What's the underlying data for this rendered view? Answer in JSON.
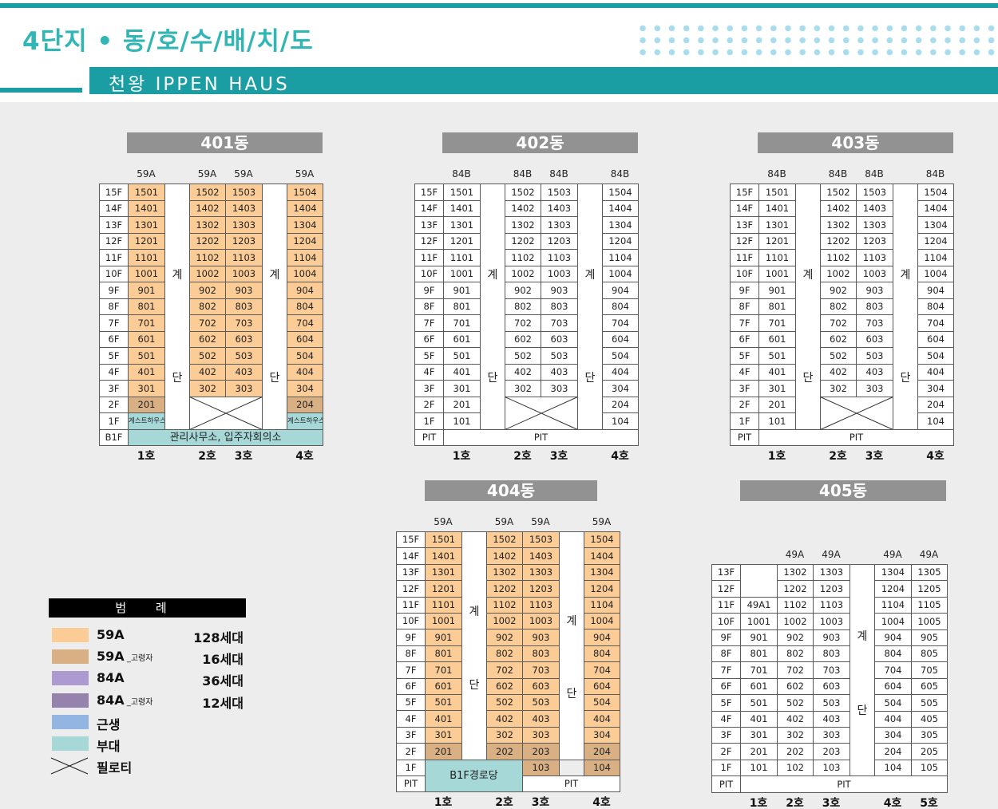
{
  "header": {
    "title": "4단지 • 동/호/수/배/치/도",
    "subtitle": "천왕 IPPEN HAUS"
  },
  "colors": {
    "c59": "#fbcc95",
    "c59e": "#d8b083",
    "c84": "#ac9ad0",
    "c84e": "#9583ad",
    "shop": "#92b5e2",
    "aux": "#a6d8d8",
    "plain": "#ffffff",
    "accent": "#1a9ea4"
  },
  "buildings": [
    {
      "name": "401동",
      "types": [
        "59A",
        "59A",
        "59A",
        "59A"
      ],
      "units": [
        "1호",
        "2호",
        "3호",
        "4호"
      ],
      "stair": [
        "계",
        "단"
      ],
      "floors": [
        "15F",
        "14F",
        "13F",
        "12F",
        "11F",
        "10F",
        "9F",
        "8F",
        "7F",
        "6F",
        "5F",
        "4F",
        "3F",
        "2F",
        "1F",
        "B1F"
      ],
      "cols": [
        [
          "1501",
          "1401",
          "1301",
          "1201",
          "1101",
          "1001",
          "901",
          "801",
          "701",
          "601",
          "501",
          "401",
          "301",
          "201",
          "게스트하우스"
        ],
        [
          "1502",
          "1402",
          "1302",
          "1202",
          "1102",
          "1002",
          "902",
          "802",
          "702",
          "602",
          "502",
          "402",
          "302"
        ],
        [
          "1503",
          "1403",
          "1303",
          "1203",
          "1103",
          "1003",
          "903",
          "803",
          "703",
          "603",
          "503",
          "403",
          "303"
        ],
        [
          "1504",
          "1404",
          "1304",
          "1204",
          "1104",
          "1004",
          "904",
          "804",
          "704",
          "604",
          "504",
          "404",
          "304",
          "204",
          "게스트하우스"
        ]
      ],
      "bottom": "관리사무소, 입주자회의소"
    },
    {
      "name": "402동",
      "types": [
        "84B",
        "84B",
        "84B",
        "84B"
      ],
      "units": [
        "1호",
        "2호",
        "3호",
        "4호"
      ],
      "stair": [
        "계",
        "단"
      ],
      "floors": [
        "15F",
        "14F",
        "13F",
        "12F",
        "11F",
        "10F",
        "9F",
        "8F",
        "7F",
        "6F",
        "5F",
        "4F",
        "3F",
        "2F",
        "1F",
        "PIT"
      ],
      "cols": [
        [
          "1501",
          "1401",
          "1301",
          "1201",
          "1101",
          "1001",
          "901",
          "801",
          "701",
          "601",
          "501",
          "401",
          "301",
          "201",
          "101"
        ],
        [
          "1502",
          "1402",
          "1302",
          "1202",
          "1102",
          "1002",
          "902",
          "802",
          "702",
          "602",
          "502",
          "402",
          "302"
        ],
        [
          "1503",
          "1403",
          "1303",
          "1203",
          "1103",
          "1003",
          "903",
          "803",
          "703",
          "603",
          "503",
          "403",
          "303"
        ],
        [
          "1504",
          "1404",
          "1304",
          "1204",
          "1104",
          "1004",
          "904",
          "804",
          "704",
          "604",
          "504",
          "404",
          "304",
          "204",
          "104"
        ]
      ],
      "bottom": "PIT"
    },
    {
      "name": "403동",
      "types": [
        "84B",
        "84B",
        "84B",
        "84B"
      ],
      "units": [
        "1호",
        "2호",
        "3호",
        "4호"
      ],
      "stair": [
        "계",
        "단"
      ],
      "floors": [
        "15F",
        "14F",
        "13F",
        "12F",
        "11F",
        "10F",
        "9F",
        "8F",
        "7F",
        "6F",
        "5F",
        "4F",
        "3F",
        "2F",
        "1F",
        "PIT"
      ],
      "cols": [
        [
          "1501",
          "1401",
          "1301",
          "1201",
          "1101",
          "1001",
          "901",
          "801",
          "701",
          "601",
          "501",
          "401",
          "301",
          "201",
          "101"
        ],
        [
          "1502",
          "1402",
          "1302",
          "1202",
          "1102",
          "1002",
          "902",
          "802",
          "702",
          "602",
          "502",
          "402",
          "302"
        ],
        [
          "1503",
          "1403",
          "1303",
          "1203",
          "1103",
          "1003",
          "903",
          "803",
          "703",
          "603",
          "503",
          "403",
          "303"
        ],
        [
          "1504",
          "1404",
          "1304",
          "1204",
          "1104",
          "1004",
          "904",
          "804",
          "704",
          "604",
          "504",
          "404",
          "304",
          "204",
          "104"
        ]
      ],
      "bottom": "PIT"
    },
    {
      "name": "404동",
      "types": [
        "59A",
        "59A",
        "59A",
        "59A"
      ],
      "units": [
        "1호",
        "2호",
        "3호",
        "4호"
      ],
      "stair": [
        "계",
        "단"
      ],
      "floors": [
        "15F",
        "14F",
        "13F",
        "12F",
        "11F",
        "10F",
        "9F",
        "8F",
        "7F",
        "6F",
        "5F",
        "4F",
        "3F",
        "2F",
        "1F",
        "PIT"
      ],
      "cols": [
        [
          "1501",
          "1401",
          "1301",
          "1201",
          "1101",
          "1001",
          "901",
          "801",
          "701",
          "601",
          "501",
          "401",
          "301",
          "201"
        ],
        [
          "1502",
          "1402",
          "1302",
          "1202",
          "1102",
          "1002",
          "902",
          "802",
          "702",
          "602",
          "502",
          "402",
          "302",
          "202"
        ],
        [
          "1503",
          "1403",
          "1303",
          "1203",
          "1103",
          "1003",
          "903",
          "803",
          "703",
          "603",
          "503",
          "403",
          "303",
          "203",
          "103"
        ],
        [
          "1504",
          "1404",
          "1304",
          "1204",
          "1104",
          "1004",
          "904",
          "804",
          "704",
          "604",
          "504",
          "404",
          "304",
          "204",
          "104"
        ]
      ],
      "passage": "B1F경로당",
      "bottom": "PIT"
    },
    {
      "name": "405동",
      "types": [
        "49A",
        "49A",
        "49A",
        "49A"
      ],
      "units": [
        "1호",
        "2호",
        "3호",
        "4호",
        "5호"
      ],
      "stair": [
        "계",
        "단"
      ],
      "floors": [
        "13F",
        "12F",
        "11F",
        "10F",
        "9F",
        "8F",
        "7F",
        "6F",
        "5F",
        "4F",
        "3F",
        "2F",
        "1F",
        "PIT"
      ],
      "col1_label": "49A1",
      "col1": [
        "1001",
        "901",
        "801",
        "701",
        "601",
        "501",
        "401",
        "301",
        "201",
        "101"
      ],
      "cols": [
        [
          "1302",
          "1202",
          "1102",
          "1002",
          "902",
          "802",
          "702",
          "602",
          "502",
          "402",
          "302",
          "202",
          "102"
        ],
        [
          "1303",
          "1203",
          "1103",
          "1003",
          "903",
          "803",
          "703",
          "603",
          "503",
          "403",
          "303",
          "203",
          "103"
        ],
        [
          "1304",
          "1204",
          "1104",
          "1004",
          "904",
          "804",
          "704",
          "604",
          "504",
          "404",
          "304",
          "204",
          "104"
        ],
        [
          "1305",
          "1205",
          "1105",
          "1005",
          "905",
          "805",
          "705",
          "605",
          "505",
          "405",
          "305",
          "205",
          "105"
        ]
      ],
      "bottom": "PIT"
    }
  ],
  "legend": {
    "title": "범 례",
    "items": [
      {
        "label": "59A",
        "sub": "",
        "count": "128세대",
        "swatch": "c59"
      },
      {
        "label": "59A",
        "sub": "_고령자",
        "count": "16세대",
        "swatch": "c59e"
      },
      {
        "label": "84A",
        "sub": "",
        "count": "36세대",
        "swatch": "c84"
      },
      {
        "label": "84A",
        "sub": "_고령자",
        "count": "12세대",
        "swatch": "c84e"
      },
      {
        "label": "근생",
        "sub": "",
        "count": "",
        "swatch": "shop"
      },
      {
        "label": "부대",
        "sub": "",
        "count": "",
        "swatch": "aux"
      },
      {
        "label": "필로티",
        "sub": "",
        "count": "",
        "swatch": "piloti"
      }
    ]
  }
}
